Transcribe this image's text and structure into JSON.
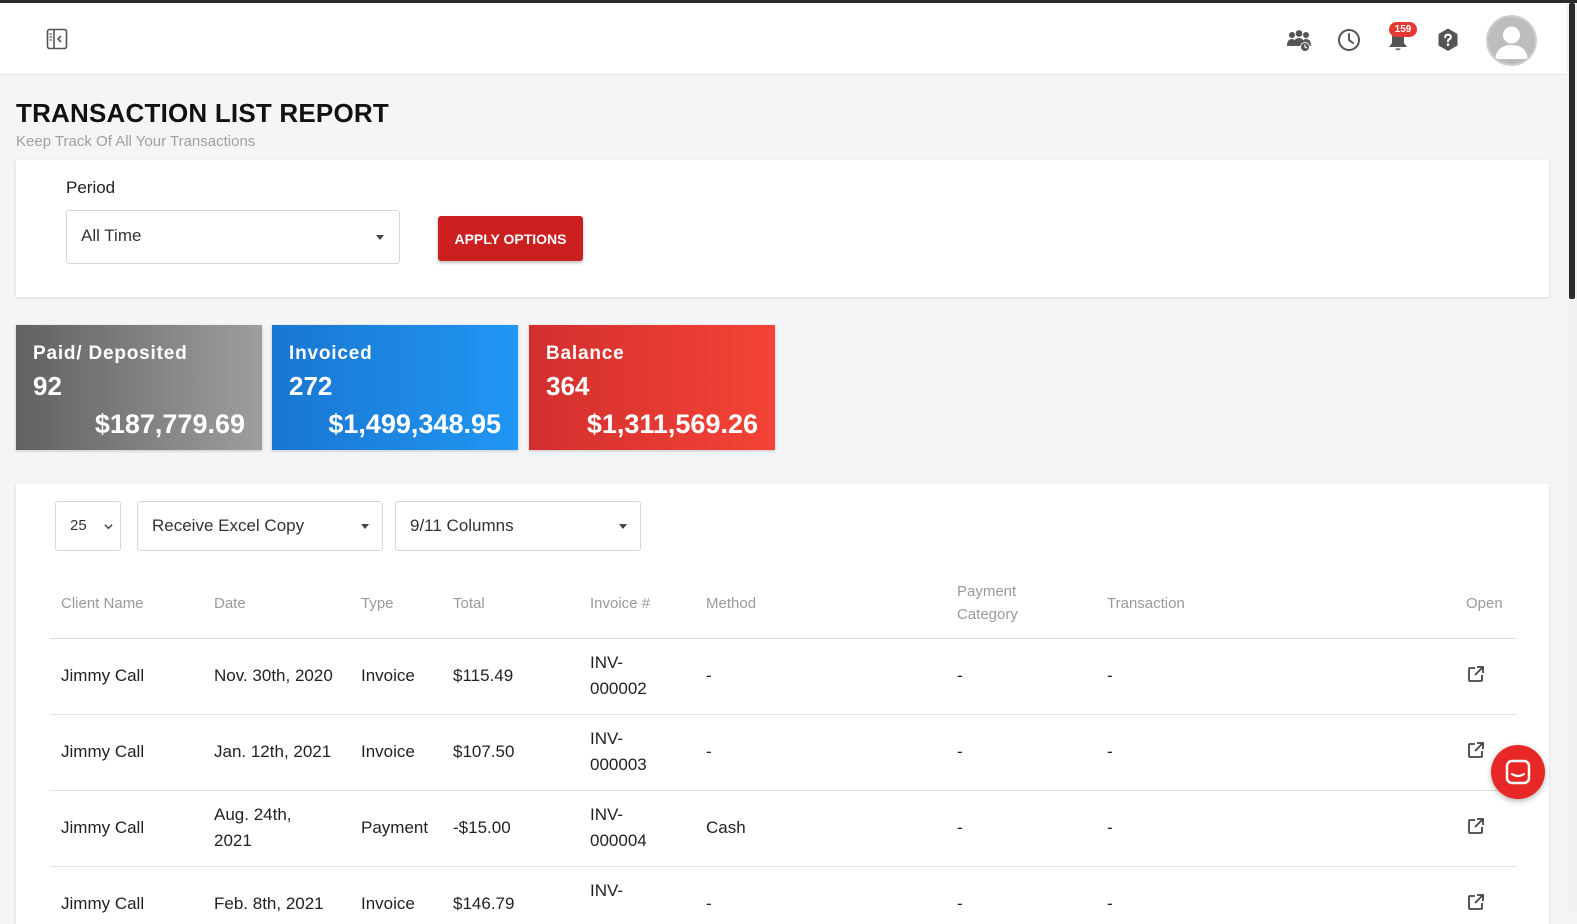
{
  "header": {
    "notification_count": "159",
    "icons": [
      "sidebar-toggle-icon",
      "team-icon",
      "clock-icon",
      "bell-icon",
      "help-icon",
      "avatar"
    ]
  },
  "page": {
    "title": "TRANSACTION LIST REPORT",
    "subtitle": "Keep Track Of All Your Transactions"
  },
  "options": {
    "period_label": "Period",
    "period_value": "All Time",
    "apply_label": "APPLY OPTIONS"
  },
  "stats": [
    {
      "label": "Paid/ Deposited",
      "count": "92",
      "amount": "$187,779.69",
      "color": "#757575"
    },
    {
      "label": "Invoiced",
      "count": "272",
      "amount": "$1,499,348.95",
      "color": "#1e88e5"
    },
    {
      "label": "Balance",
      "count": "364",
      "amount": "$1,311,569.26",
      "color": "#e53935"
    }
  ],
  "table_controls": {
    "page_size": "25",
    "export": "Receive Excel Copy",
    "columns": "9/11 Columns"
  },
  "table": {
    "headers": {
      "client_name": "Client Name",
      "date": "Date",
      "type": "Type",
      "total": "Total",
      "invoice": "Invoice #",
      "method": "Method",
      "payment_category_1": "Payment",
      "payment_category_2": "Category",
      "transaction": "Transaction",
      "open": "Open"
    },
    "rows": [
      {
        "client": "Jimmy Call",
        "date_1": "Nov. 30th, 2020",
        "date_2": "",
        "type": "Invoice",
        "total": "$115.49",
        "inv_1": "INV-",
        "inv_2": "000002",
        "method": "-",
        "category": "-",
        "transaction": "-"
      },
      {
        "client": "Jimmy Call",
        "date_1": "Jan. 12th, 2021",
        "date_2": "",
        "type": "Invoice",
        "total": "$107.50",
        "inv_1": "INV-",
        "inv_2": "000003",
        "method": "-",
        "category": "-",
        "transaction": "-"
      },
      {
        "client": "Jimmy Call",
        "date_1": "Aug. 24th,",
        "date_2": "2021",
        "type": "Payment",
        "total": "-$15.00",
        "inv_1": "INV-",
        "inv_2": "000004",
        "method": "Cash",
        "category": "-",
        "transaction": "-"
      },
      {
        "client": "Jimmy Call",
        "date_1": "Feb. 8th, 2021",
        "date_2": "",
        "type": "Invoice",
        "total": "$146.79",
        "inv_1": "INV-",
        "inv_2": "",
        "method": "-",
        "category": "-",
        "transaction": "-"
      }
    ]
  },
  "colors": {
    "accent_red": "#cc1f1f",
    "chat_button": "#e82727"
  }
}
